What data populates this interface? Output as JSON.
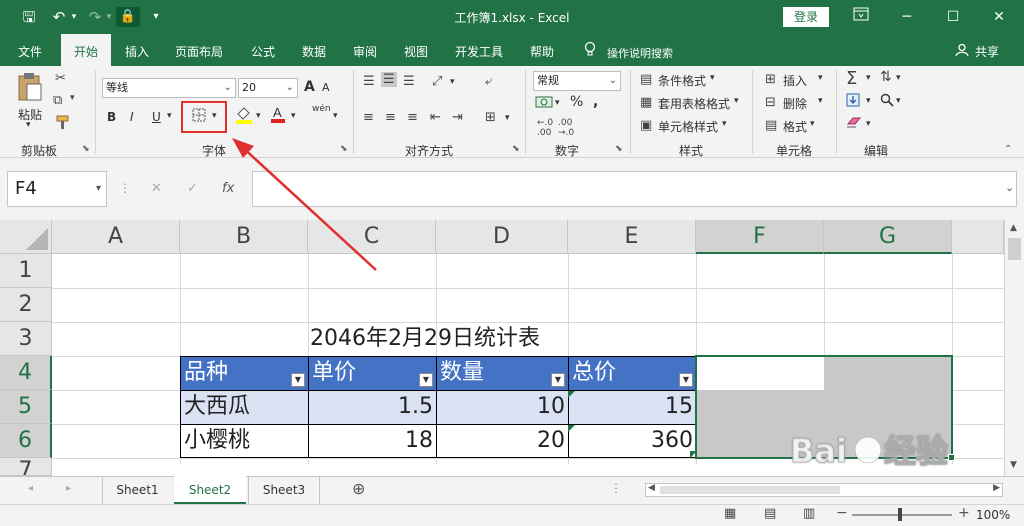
{
  "window": {
    "title": "工作簿1.xlsx  -  Excel",
    "login_label": "登录",
    "ribbon_display_icon": "ribbon-display-icon",
    "min_icon": "─",
    "max_icon": "☐",
    "close_icon": "✕"
  },
  "qat": {
    "save": "🖫",
    "undo": "↶",
    "redo": "↷",
    "lock": "🔒",
    "more": "▾"
  },
  "menu": {
    "tabs": [
      "文件",
      "开始",
      "插入",
      "页面布局",
      "公式",
      "数据",
      "审阅",
      "视图",
      "开发工具",
      "帮助"
    ],
    "tell_me": "操作说明搜索",
    "share": "共享"
  },
  "ribbon": {
    "clipboard": {
      "paste": "粘贴",
      "group": "剪贴板"
    },
    "font": {
      "font_name": "等线",
      "font_size": "20",
      "bold": "B",
      "italic": "I",
      "underline": "U",
      "grow": "A",
      "shrink": "A",
      "wen": "wén",
      "group": "字体"
    },
    "alignment": {
      "group": "对齐方式"
    },
    "number": {
      "format": "常规",
      "percent": "%",
      "group": "数字"
    },
    "styles": {
      "conditional": "条件格式",
      "table_format": "套用表格格式",
      "cell_styles": "单元格样式",
      "group": "样式"
    },
    "cells": {
      "insert": "插入",
      "delete": "删除",
      "format": "格式",
      "group": "单元格"
    },
    "editing": {
      "group": "编辑"
    }
  },
  "formula_bar": {
    "name_box": "F4",
    "cancel": "✕",
    "enter": "✓",
    "fx": "fx",
    "value": ""
  },
  "sheet": {
    "columns": [
      "A",
      "B",
      "C",
      "D",
      "E",
      "F",
      "G"
    ],
    "rows": [
      "1",
      "2",
      "3",
      "4",
      "5",
      "6",
      "7"
    ],
    "title_cell": "2046年2月29日统计表",
    "table_headers": [
      "品种",
      "单价",
      "数量",
      "总价"
    ],
    "table_rows": [
      [
        "大西瓜",
        "1.5",
        "10",
        "15"
      ],
      [
        "小樱桃",
        "18",
        "20",
        "360"
      ]
    ]
  },
  "sheet_tabs": [
    "Sheet1",
    "Sheet2",
    "Sheet3"
  ],
  "active_sheet": "Sheet2",
  "status": {
    "zoom": "100%"
  },
  "colors": {
    "excel_green": "#217346",
    "table_header": "#4472c4",
    "table_band": "#d9e1f2",
    "highlight": "#e03030"
  }
}
